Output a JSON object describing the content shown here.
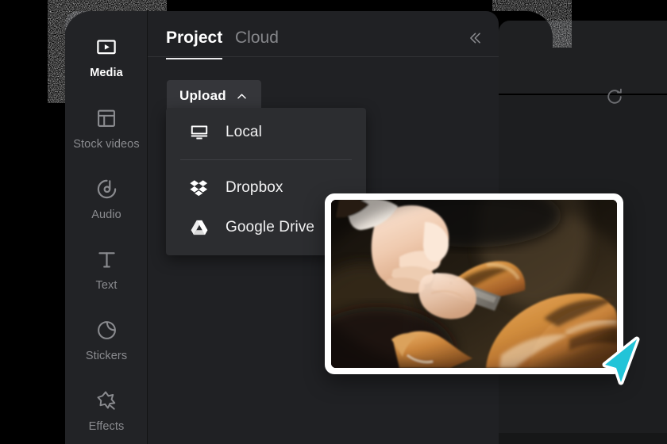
{
  "app": {
    "background_color": "#000000",
    "panel_color": "#202124",
    "rail_color": "#222326",
    "accent_cursor_color": "#22c4d8"
  },
  "sidebar": {
    "name": "tool-rail",
    "items": [
      {
        "label": "Media",
        "icon": "media-play-rect-icon",
        "active": true
      },
      {
        "label": "Stock videos",
        "icon": "layout-grid-icon",
        "active": false
      },
      {
        "label": "Audio",
        "icon": "music-note-circle-icon",
        "active": false
      },
      {
        "label": "Text",
        "icon": "text-t-icon",
        "active": false
      },
      {
        "label": "Stickers",
        "icon": "sticker-circle-icon",
        "active": false
      },
      {
        "label": "Effects",
        "icon": "star-sparkle-icon",
        "active": false
      }
    ]
  },
  "media_panel": {
    "tabs": [
      {
        "label": "Project",
        "active": true
      },
      {
        "label": "Cloud",
        "active": false
      }
    ],
    "collapse_icon": "chevron-double-left-icon",
    "upload": {
      "label": "Upload",
      "chevron_icon": "chevron-up-icon",
      "expanded": true
    },
    "refresh_icon": "refresh-icon",
    "upload_menu": {
      "items": [
        {
          "label": "Local",
          "icon": "monitor-icon"
        },
        {
          "label": "Dropbox",
          "icon": "dropbox-icon"
        },
        {
          "label": "Google Drive",
          "icon": "google-drive-icon"
        }
      ],
      "divider_after_index": 0
    }
  },
  "preview_card": {
    "name": "media-thumbnail-card",
    "alt": "Hands carving a roasted chicken with a knife",
    "border_color": "#ffffff"
  },
  "cursor": {
    "name": "mouse-cursor",
    "color": "#22c4d8"
  }
}
